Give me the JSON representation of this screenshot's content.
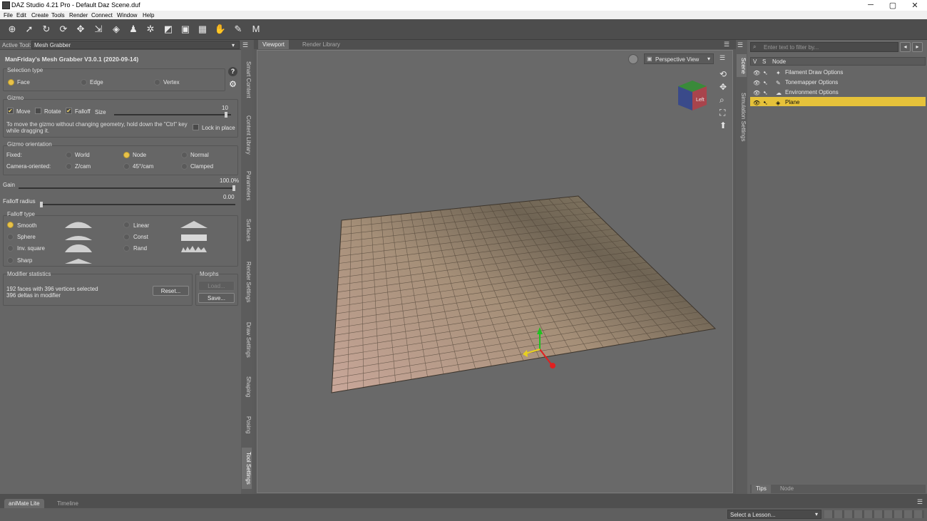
{
  "window": {
    "title": "DAZ Studio 4.21 Pro - Default Daz Scene.duf",
    "minimize": "─",
    "maximize": "▢",
    "close": "✕"
  },
  "menu": [
    "File",
    "Edit",
    "Create",
    "Tools",
    "Render",
    "Connect",
    "Window",
    "Help"
  ],
  "toolbar_icons": [
    "universal-tool-icon",
    "node-selection-icon",
    "orbit-icon",
    "rotate-icon",
    "translate-icon",
    "scale-icon",
    "surface-selection-icon",
    "joint-editor-icon",
    "spot-render-icon",
    "geometry-editor-icon",
    "camera-tool-icon",
    "region-navigator-icon",
    "pan-hand-icon",
    "mesh-grabber-icon",
    "morph-icon"
  ],
  "left": {
    "active_tool_label": "Active Tool:",
    "active_tool_value": "Mesh Grabber",
    "plugin_title": "ManFriday's Mesh Grabber V3.0.1 (2020-09-14)",
    "help_glyph": "?",
    "selection": {
      "title": "Selection type",
      "face": "Face",
      "edge": "Edge",
      "vertex": "Vertex"
    },
    "gizmo": {
      "title": "Gizmo",
      "move": "Move",
      "rotate": "Rotate",
      "falloff": "Falloff",
      "size_label": "Size",
      "size_value": "10",
      "size_fraction": 0.97,
      "hint": "To move the gizmo without changing geometry, hold down the \"Ctrl\" key while dragging it.",
      "lock": "Lock in place"
    },
    "orientation": {
      "title": "Gizmo orientation",
      "fixed": "Fixed:",
      "world": "World",
      "node": "Node",
      "normal": "Normal",
      "camera": "Camera-oriented:",
      "zcam": "Z/cam",
      "cam45": "45°/cam",
      "clamped": "Clamped"
    },
    "gain": {
      "label": "Gain",
      "value": "100.0%",
      "fraction": 1.0
    },
    "falloff_radius": {
      "label": "Falloff radius",
      "value": "0.00",
      "fraction": 0.0
    },
    "falloff_type": {
      "title": "Falloff type",
      "smooth": "Smooth",
      "sphere": "Sphere",
      "inv_square": "Inv. square",
      "sharp": "Sharp",
      "linear": "Linear",
      "const": "Const",
      "rand": "Rand"
    },
    "stats": {
      "title": "Modifier statistics",
      "line1": "192 faces with 396 vertices selected",
      "line2": "396 deltas in modifier",
      "reset": "Reset..."
    },
    "morphs": {
      "title": "Morphs",
      "load": "Load...",
      "save": "Save..."
    }
  },
  "left_vtabs": [
    "Smart Content",
    "Content Library",
    "Parameters",
    "Surfaces",
    "Render Settings",
    "Draw Settings",
    "Shaping",
    "Posing",
    "Tool Settings"
  ],
  "viewport": {
    "tabs": [
      "Viewport",
      "Render Library"
    ],
    "view_name": "Perspective View",
    "cube_label": "Left",
    "colors": {
      "x_axis": "#e02020",
      "y_axis": "#20c020",
      "z_axis": "#e8d020"
    }
  },
  "scene": {
    "filter_placeholder": "Enter text to filter by...",
    "col_v": "V",
    "col_s": "S",
    "col_node": "Node",
    "items": [
      "Filament Draw Options",
      "Tonemapper Options",
      "Environment Options",
      "Plane"
    ],
    "selected_index": 3,
    "bottom_tabs": [
      "Tips",
      "Node"
    ]
  },
  "right_vtabs": [
    "Scene",
    "Simulation Settings"
  ],
  "bottom": {
    "tabs": [
      "aniMate Lite",
      "Timeline"
    ],
    "lesson_placeholder": "Select a Lesson..."
  }
}
